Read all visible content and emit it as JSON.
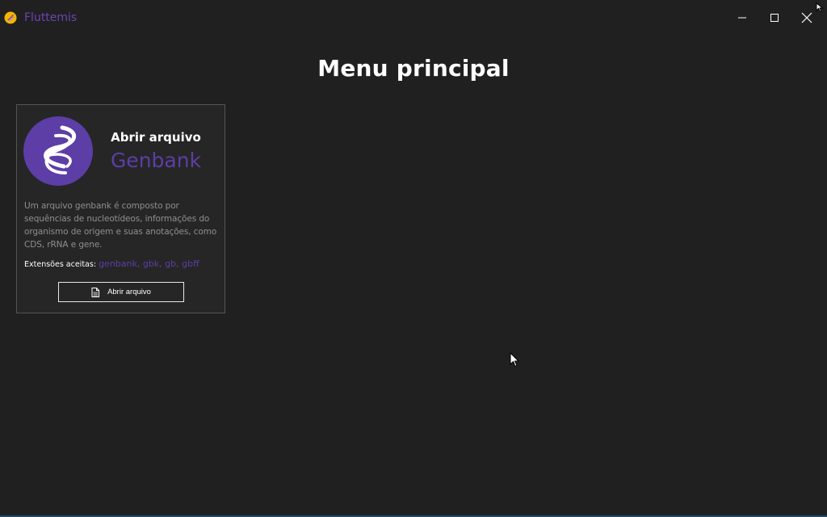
{
  "window": {
    "title": "Fluttemis",
    "controls": [
      "minimize",
      "maximize",
      "close"
    ]
  },
  "page": {
    "title": "Menu principal"
  },
  "card": {
    "heading_small": "Abrir arquivo",
    "heading_big": "Genbank",
    "description": "Um arquivo genbank é composto por sequências de nucleotídeos, informações do organismo de origem e suas anotações, como CDS, rRNA e gene.",
    "extensions_label": "Extensões aceitas:",
    "extensions_values": "genbank, gbk, gb, gbff",
    "button_label": "Abrir arquivo"
  },
  "icons": {
    "app": "flutter-app-icon",
    "logo": "dna-helix-icon",
    "button": "file-icon"
  },
  "colors": {
    "background": "#202020",
    "accent": "#5c3ea6",
    "title_text": "#6b44b2"
  }
}
